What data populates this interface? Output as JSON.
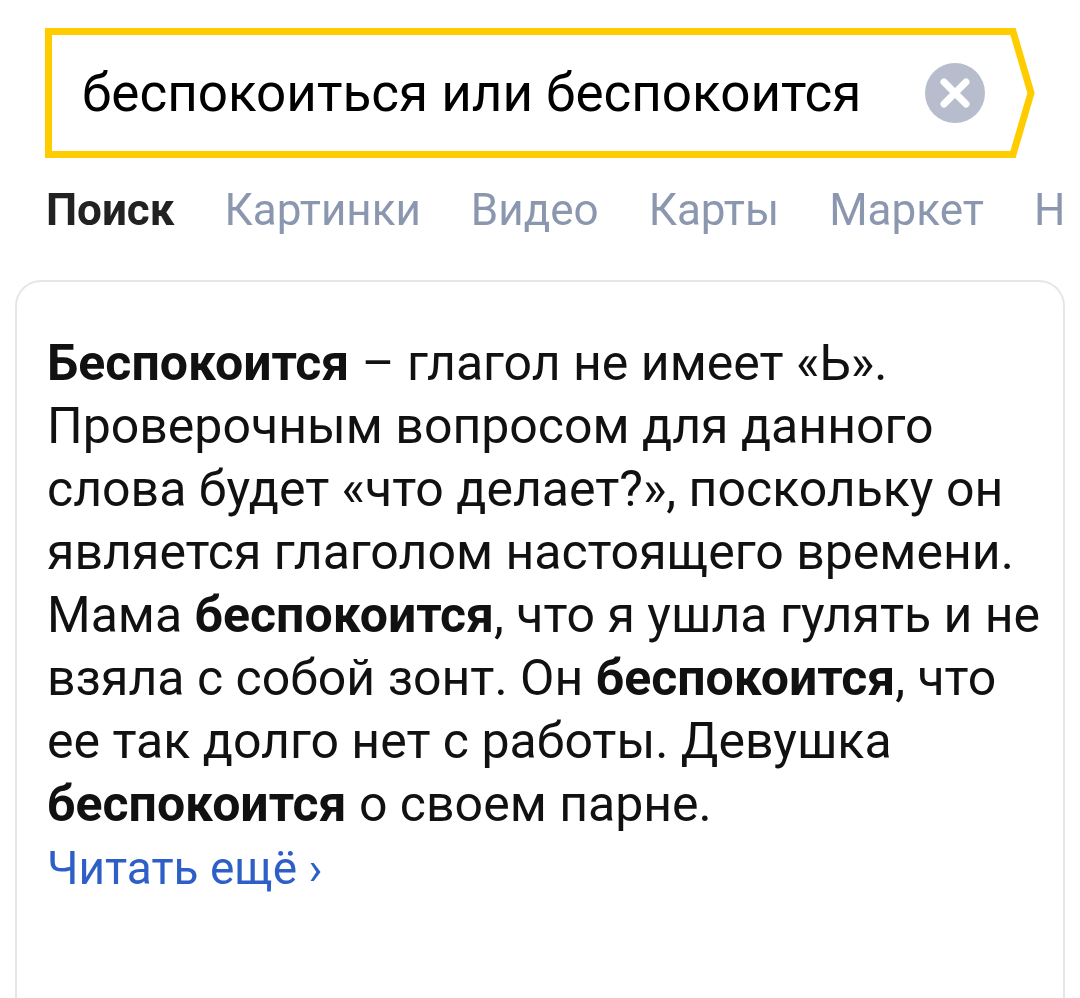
{
  "search": {
    "value": "беспокоиться или беспокоится"
  },
  "tabs": [
    {
      "label": "Поиск",
      "selected": true
    },
    {
      "label": "Картинки",
      "selected": false
    },
    {
      "label": "Видео",
      "selected": false
    },
    {
      "label": "Карты",
      "selected": false
    },
    {
      "label": "Маркет",
      "selected": false
    },
    {
      "label": "Н",
      "selected": false
    }
  ],
  "card": {
    "text": "**Беспокоится** – глагол не имеет «Ь». Проверочным вопросом для данного слова будет «что делает?», поскольку он является глаголом настоящего времени. Мама **беспокоится**, что я ушла гулять и не взяла с собой зонт. Он **беспокоится**, что ее так долго нет с работы. Девушка **беспокоится** о своем парне.",
    "link": "Читать ещё ›"
  }
}
